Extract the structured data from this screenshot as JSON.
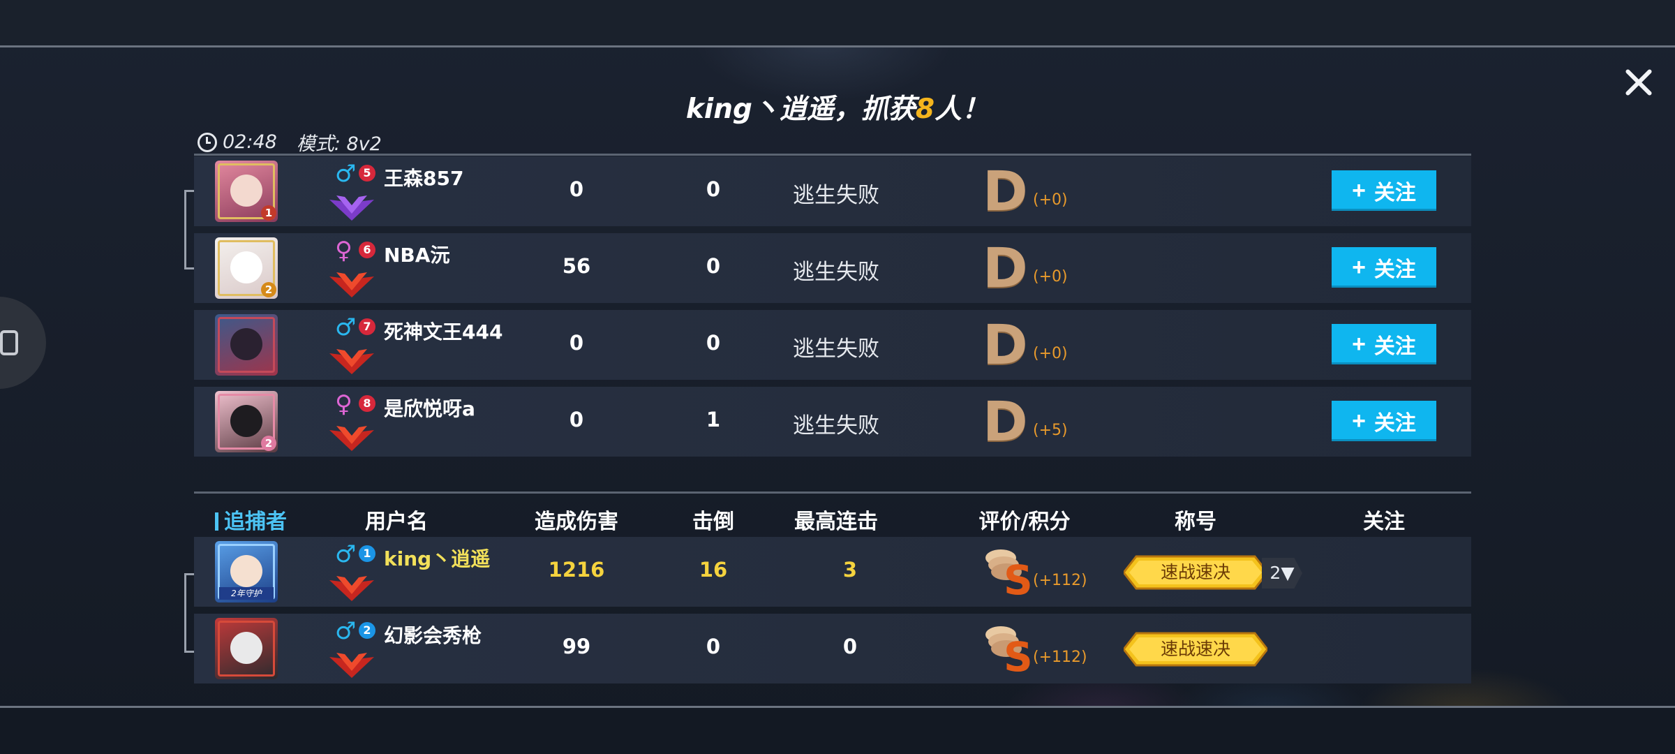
{
  "header": {
    "title_prefix": "king丶逍遥，抓获",
    "title_count": "8",
    "title_suffix": "人！",
    "time": "02:48",
    "mode": "模式: 8v2"
  },
  "escapers": [
    {
      "seat": "5",
      "gender": "♂",
      "name": "王森857",
      "damage": "0",
      "kills": "0",
      "status": "逃生失败",
      "grade": "D",
      "points": "(+0)",
      "avatar_rank": "1",
      "follow": "关注"
    },
    {
      "seat": "6",
      "gender": "♀",
      "name": "NBA沅",
      "damage": "56",
      "kills": "0",
      "status": "逃生失败",
      "grade": "D",
      "points": "(+0)",
      "avatar_rank": "2",
      "follow": "关注"
    },
    {
      "seat": "7",
      "gender": "♂",
      "name": "死神文王444",
      "damage": "0",
      "kills": "0",
      "status": "逃生失败",
      "grade": "D",
      "points": "(+0)",
      "avatar_rank": "",
      "follow": "关注"
    },
    {
      "seat": "8",
      "gender": "♀",
      "name": "是欣悦呀a",
      "damage": "0",
      "kills": "1",
      "status": "逃生失败",
      "grade": "D",
      "points": "(+5)",
      "avatar_rank": "2",
      "follow": "关注"
    }
  ],
  "columns": {
    "team": "追捕者",
    "username": "用户名",
    "damage": "造成伤害",
    "kills": "击倒",
    "combo": "最高连击",
    "grade": "评价/积分",
    "title": "称号",
    "follow": "关注"
  },
  "hunters": [
    {
      "seat": "1",
      "gender": "♂",
      "name": "king丶逍遥",
      "damage": "1216",
      "kills": "16",
      "combo": "3",
      "grade": "S",
      "points": "(+112)",
      "title": "速战速决",
      "title_count": "2▼",
      "avatar_label": "2年守护"
    },
    {
      "seat": "2",
      "gender": "♂",
      "name": "幻影会秀枪",
      "damage": "99",
      "kills": "0",
      "combo": "0",
      "grade": "S",
      "points": "(+112)",
      "title": "速战速决",
      "title_count": "",
      "avatar_label": ""
    }
  ],
  "colors": {
    "accent": "#0fb6ef",
    "gold": "#f5b51d",
    "grade_d": "#caa27a",
    "grade_s": "#e25a16"
  }
}
